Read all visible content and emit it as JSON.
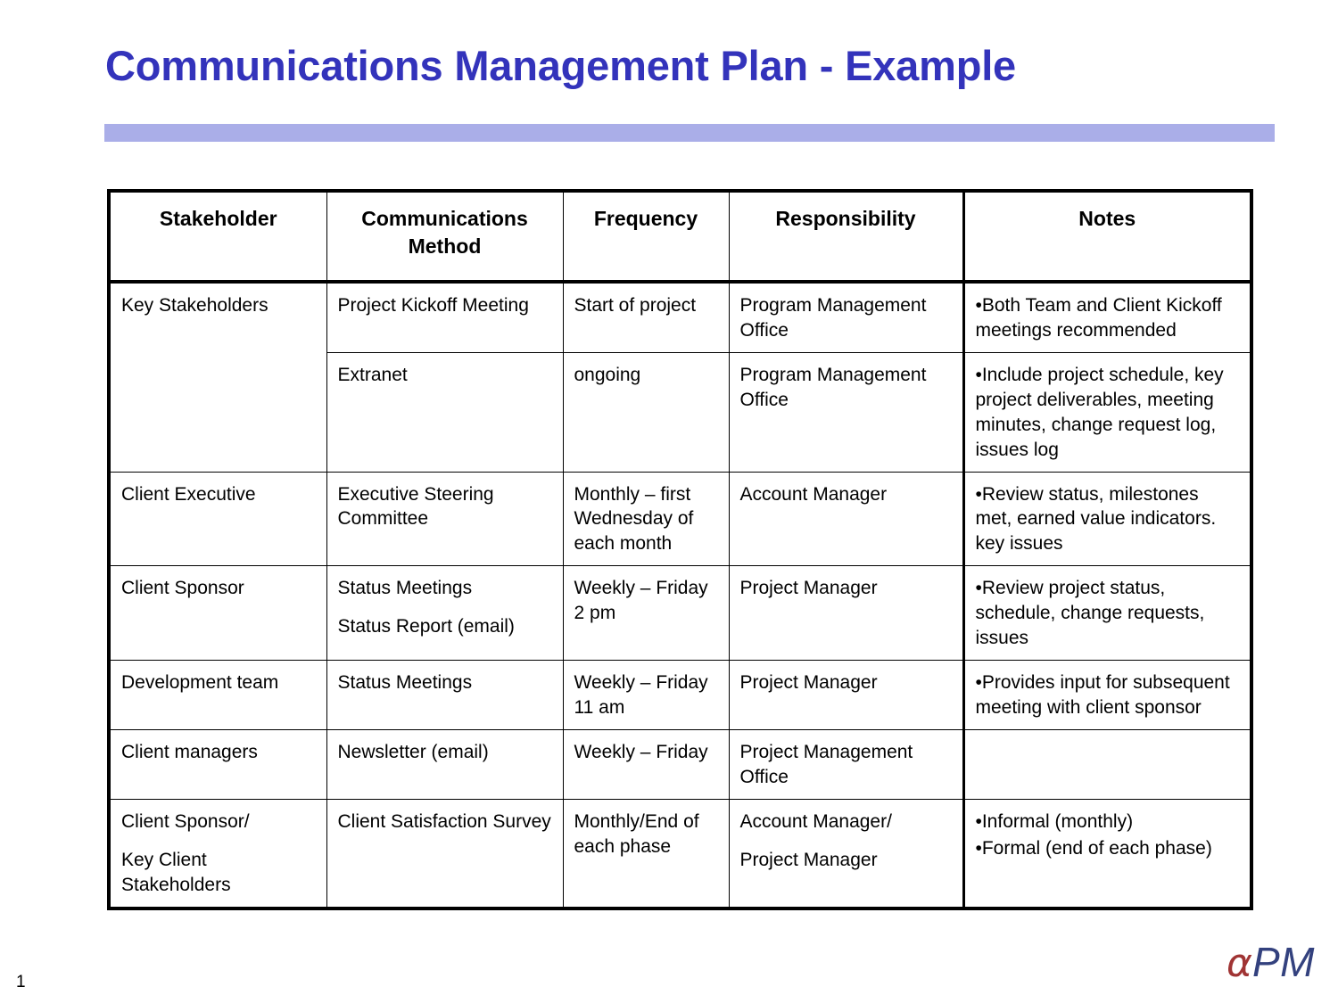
{
  "slide": {
    "title": "Communications Management Plan - Example",
    "page_number": "1",
    "accent_bar_color": "#aaaee8",
    "title_color": "#3333bb"
  },
  "logo": {
    "alpha": "α",
    "pm": "PM",
    "alpha_color": "#a03434",
    "pm_color": "#33417e"
  },
  "table": {
    "headers": [
      "Stakeholder",
      "Communications Method",
      "Frequency",
      "Responsibility",
      "Notes"
    ],
    "rows": [
      {
        "stakeholder": "Key Stakeholders",
        "stakeholder_rowspan": 2,
        "method": "Project Kickoff Meeting",
        "frequency": "Start of project",
        "responsibility": "Program Management Office",
        "notes": [
          "•Both Team and Client Kickoff meetings recommended"
        ]
      },
      {
        "stakeholder": null,
        "method": "Extranet",
        "frequency": "ongoing",
        "responsibility": "Program Management Office",
        "notes": [
          "•Include project schedule, key project  deliverables, meeting minutes, change request log, issues log"
        ]
      },
      {
        "stakeholder": "Client Executive",
        "method": "Executive Steering Committee",
        "frequency": "Monthly – first Wednesday of each month",
        "responsibility": "Account Manager",
        "notes": [
          "•Review status, milestones met, earned value indicators. key issues"
        ]
      },
      {
        "stakeholder": "Client Sponsor",
        "method_lines": [
          "Status Meetings",
          "Status Report (email)"
        ],
        "frequency": "Weekly – Friday  2 pm",
        "responsibility": "Project Manager",
        "notes": [
          "•Review project status, schedule, change requests, issues"
        ]
      },
      {
        "stakeholder": "Development team",
        "method": "Status Meetings",
        "frequency": "Weekly – Friday 11 am",
        "responsibility": "Project Manager",
        "notes": [
          "•Provides input for subsequent meeting with client sponsor"
        ]
      },
      {
        "stakeholder": "Client managers",
        "method": "Newsletter (email)",
        "frequency": "Weekly – Friday",
        "responsibility": "Project Management Office",
        "notes": []
      },
      {
        "stakeholder_lines": [
          "Client Sponsor/",
          "Key Client Stakeholders"
        ],
        "method": "Client Satisfaction Survey",
        "frequency": "Monthly/End of each phase",
        "responsibility_lines": [
          "Account Manager/",
          "Project Manager"
        ],
        "notes": [
          "•Informal (monthly)",
          "•Formal (end of each phase)"
        ]
      }
    ]
  }
}
